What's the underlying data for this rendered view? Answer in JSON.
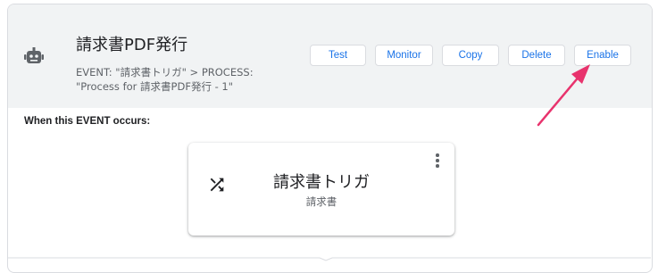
{
  "header": {
    "title": "請求書PDF発行",
    "subtitle": "EVENT: \"請求書トリガ\" > PROCESS: \"Process for 請求書PDF発行 - 1\"",
    "icon": "robot-icon"
  },
  "buttons": {
    "test": "Test",
    "monitor": "Monitor",
    "copy": "Copy",
    "delete": "Delete",
    "enable": "Enable"
  },
  "section": {
    "label": "When this EVENT occurs:"
  },
  "event": {
    "title": "請求書トリガ",
    "subtitle": "請求書",
    "icon": "shuffle-icon",
    "menu_icon": "more-vert-icon"
  },
  "colors": {
    "accent": "#1a73e8",
    "annotation_arrow": "#e8336d",
    "header_bg": "#f1f3f4"
  }
}
